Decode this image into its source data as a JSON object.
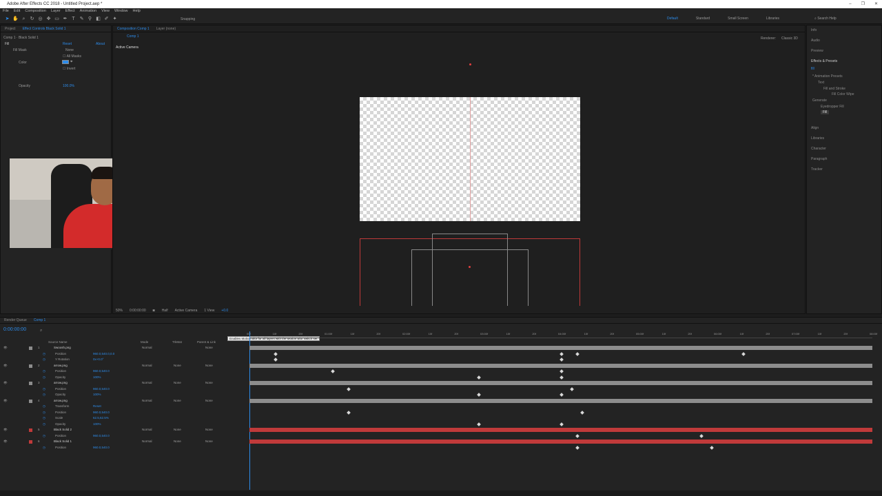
{
  "window": {
    "title": "Adobe After Effects CC 2018 - Untitled Project.aep *"
  },
  "menu": [
    "File",
    "Edit",
    "Composition",
    "Layer",
    "Effect",
    "Animation",
    "View",
    "Window",
    "Help"
  ],
  "toolbar": {
    "snapping": "Snapping",
    "workspaces": [
      "Default",
      "Standard",
      "Small Screen",
      "Libraries"
    ],
    "search_placeholder": "Search Help"
  },
  "effects_panel": {
    "tabs": [
      "Project",
      "Effect Controls Black Solid 1"
    ],
    "layer_path": "Comp 1 · Black Solid 1",
    "effect_name": "Fill",
    "reset": "Reset",
    "about": "About",
    "fill_mask_label": "Fill Mask",
    "fill_mask_value": "None",
    "all_masks": "All Masks",
    "color_label": "Color",
    "invert": "Invert",
    "opacity_label": "Opacity",
    "opacity_value": "100.0%"
  },
  "comp_panel": {
    "tabs": [
      "Composition Comp 1",
      "Layer (none)"
    ],
    "comp_tab": "Comp 1",
    "active_camera": "Active Camera",
    "renderer": "Renderer:",
    "renderer_value": "Classic 3D",
    "zoom": "50%",
    "time": "0:00:00:00",
    "resolution": "Half",
    "camera_select": "Active Camera",
    "view": "1 View",
    "exposure": "+0.0"
  },
  "right_panel": {
    "items": [
      "Info",
      "Audio",
      "Preview",
      "Effects & Presets",
      "Align",
      "Libraries",
      "Character",
      "Paragraph",
      "Tracker"
    ],
    "search_value": "fill",
    "tree": [
      "* Animation Presets",
      "Text",
      "Fill and Stroke",
      "Fill Color Wipe",
      "Generate",
      "Eyedropper Fill",
      "Fill"
    ]
  },
  "timeline": {
    "tabs": [
      "Render Queue",
      "Comp 1"
    ],
    "timecode": "0:00:00:00",
    "tooltip": "Enables Motion Blur for all layers with the Motion Blur switch set",
    "headers": [
      "Source Name",
      "Mode",
      "TrkMat",
      "Parent & Link"
    ],
    "ruler": [
      "00f",
      "10f",
      "20f",
      "01:00f",
      "10f",
      "20f",
      "02:00f",
      "10f",
      "20f",
      "03:00f",
      "10f",
      "20f",
      "04:00f",
      "10f",
      "20f",
      "05:00f",
      "10f",
      "20f",
      "06:00f",
      "10f",
      "20f",
      "07:00f",
      "10f",
      "20f",
      "08:00f"
    ],
    "rows": [
      {
        "num": "1",
        "name": "Swoosh.png",
        "mode": "Normal",
        "trk": "",
        "parent": "None",
        "color": "#8d8d8d"
      },
      {
        "name": "Position",
        "value": "960.0,540.0,0.0"
      },
      {
        "name": "Y Rotation",
        "value": "0x+0.0°"
      },
      {
        "num": "2",
        "name": "arrow.png",
        "mode": "Normal",
        "trk": "None",
        "parent": "None",
        "color": "#8d8d8d"
      },
      {
        "name": "Position",
        "value": "960.0,540.0"
      },
      {
        "name": "Opacity",
        "value": "100%"
      },
      {
        "num": "3",
        "name": "arrow.png",
        "mode": "Normal",
        "trk": "None",
        "parent": "None",
        "color": "#8d8d8d"
      },
      {
        "name": "Position",
        "value": "960.0,540.0"
      },
      {
        "name": "Opacity",
        "value": "100%"
      },
      {
        "num": "4",
        "name": "arrow.png",
        "mode": "Normal",
        "trk": "None",
        "parent": "None",
        "color": "#8d8d8d"
      },
      {
        "name": "Transform",
        "value": "Reset"
      },
      {
        "name": "Position",
        "value": "960.0,540.0"
      },
      {
        "name": "Scale",
        "value": "62.5,62.5%"
      },
      {
        "name": "Opacity",
        "value": "100%"
      },
      {
        "num": "5",
        "name": "Black Solid 2",
        "mode": "Normal",
        "trk": "None",
        "parent": "None",
        "color": "#c03a3a"
      },
      {
        "name": "Position",
        "value": "960.0,540.0"
      },
      {
        "num": "6",
        "name": "Black Solid 1",
        "mode": "Normal",
        "trk": "None",
        "parent": "None",
        "color": "#c03a3a"
      },
      {
        "name": "Position",
        "value": "960.0,540.0"
      }
    ]
  },
  "colors": {
    "accent": "#2d8ceb",
    "solid": "#c03a3a",
    "bar": "#8d8d8d"
  }
}
